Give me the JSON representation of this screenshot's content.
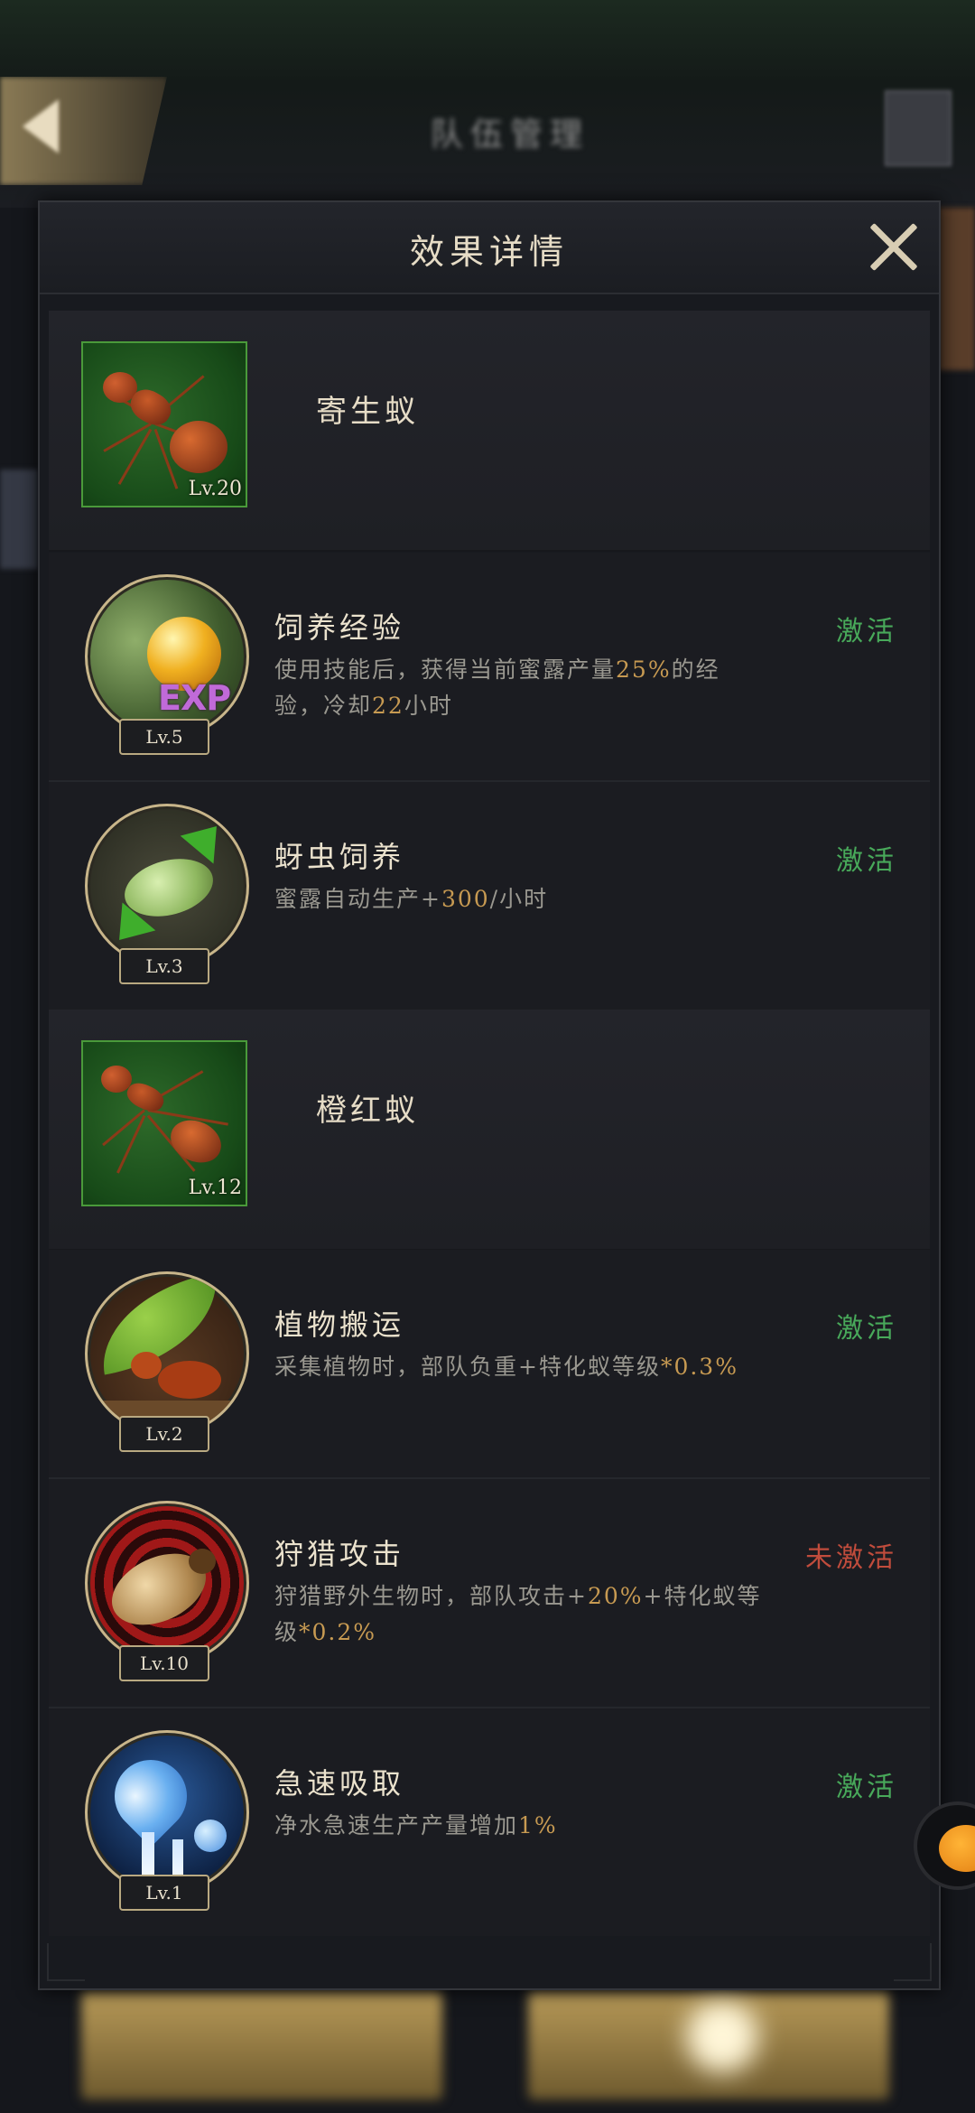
{
  "background": {
    "title": "队伍管理"
  },
  "modal": {
    "title": "效果详情",
    "close_icon": "close-icon"
  },
  "colors": {
    "active": "#48a95a",
    "inactive": "#c14c3c",
    "highlight": "#c79a52",
    "text": "#ebe2cd"
  },
  "species": [
    {
      "name": "寄生蚁",
      "level": "Lv.20",
      "icon": "ant-portrait-icon",
      "skills": [
        {
          "name": "饲养经验",
          "level": "Lv.5",
          "icon": "exp-orb-icon",
          "status": "激活",
          "active": true,
          "desc_parts": [
            "使用技能后，获得当前蜜露产量",
            "25%",
            "的经验，冷却",
            "22",
            "小时"
          ]
        },
        {
          "name": "蚜虫饲养",
          "level": "Lv.3",
          "icon": "aphid-icon",
          "status": "激活",
          "active": true,
          "desc_parts": [
            "蜜露自动生产+",
            "300",
            "/小时"
          ]
        }
      ]
    },
    {
      "name": "橙红蚁",
      "level": "Lv.12",
      "icon": "ant-portrait-icon",
      "skills": [
        {
          "name": "植物搬运",
          "level": "Lv.2",
          "icon": "leaf-carry-icon",
          "status": "激活",
          "active": true,
          "desc_parts": [
            "采集植物时，部队负重+特化蚁等级",
            "*0.3%",
            ""
          ]
        },
        {
          "name": "狩猎攻击",
          "level": "Lv.10",
          "icon": "hunting-target-icon",
          "status": "未激活",
          "active": false,
          "desc_parts": [
            "狩猎野外生物时，部队攻击+",
            "20%",
            "+特化蚁等级",
            "*0.2%",
            ""
          ]
        },
        {
          "name": "急速吸取",
          "level": "Lv.1",
          "icon": "water-drop-icon",
          "status": "激活",
          "active": true,
          "desc_parts": [
            "净水急速生产产量增加",
            "1%",
            ""
          ]
        }
      ]
    }
  ]
}
